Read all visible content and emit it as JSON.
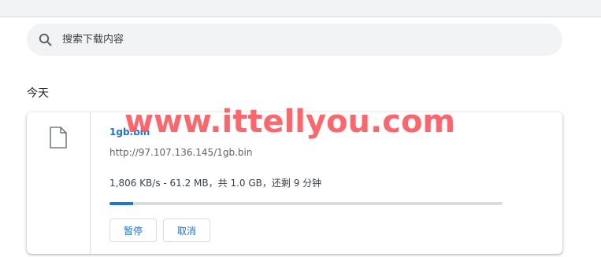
{
  "search": {
    "placeholder": "搜索下载内容",
    "icon": "search-icon"
  },
  "section": {
    "date_label": "今天"
  },
  "download": {
    "file_icon": "file-icon",
    "file_name": "1gb.bin",
    "url": "http://97.107.136.145/1gb.bin",
    "status": "1,806 KB/s - 61.2 MB，共 1.0 GB，还剩 9 分钟",
    "progress_fraction": 0.0598,
    "pause_label": "暂停",
    "cancel_label": "取消"
  },
  "watermark": {
    "text": "www.ittellyou.com"
  },
  "colors": {
    "accent": "#1a73e8",
    "watermark": "#ff5a5f",
    "search_bg": "#f1f3f4"
  }
}
